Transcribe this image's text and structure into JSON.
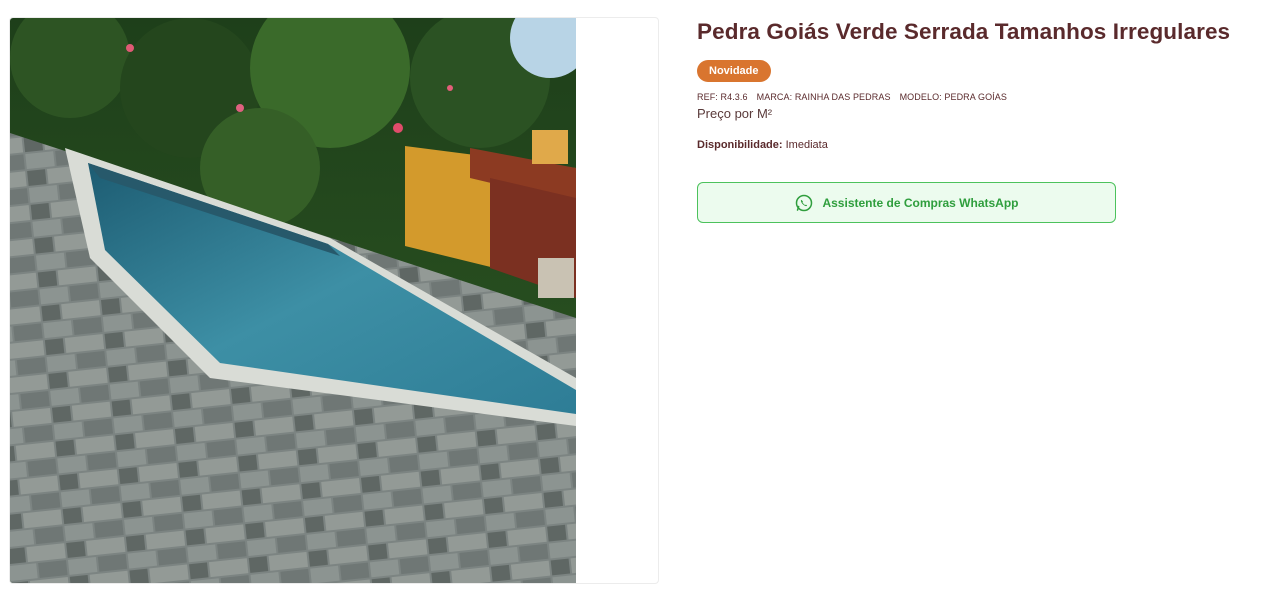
{
  "product": {
    "title": "Pedra Goiás Verde Serrada Tamanhos Irregulares",
    "badge": "Novidade",
    "ref": "REF: R4.3.6",
    "brand": "MARCA: RAINHA DAS PEDRAS",
    "model": "MODELO: PEDRA GOÍAS",
    "price_unit": "Preço por M²",
    "availability_label": "Disponibilidade:",
    "availability_value": "Imediata"
  },
  "actions": {
    "whatsapp_label": "Assistente de Compras WhatsApp",
    "whatsapp_icon": "whatsapp-icon"
  },
  "colors": {
    "title": "#5a2a2c",
    "badge": "#d9752f",
    "whatsapp_border": "#4cc25c",
    "whatsapp_bg": "#ecfbee",
    "whatsapp_text": "#2f9e3d"
  }
}
